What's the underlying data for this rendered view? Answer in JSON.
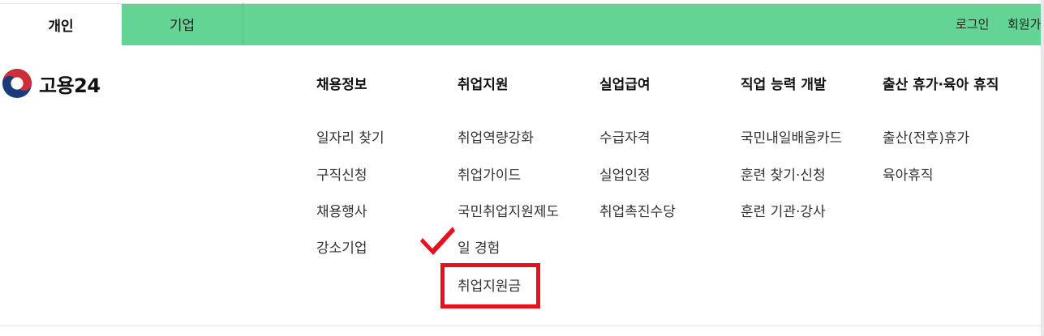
{
  "header": {
    "tabs": [
      {
        "label": "개인"
      },
      {
        "label": "기업"
      }
    ],
    "login": "로그인",
    "signup": "회원가"
  },
  "logo": {
    "text": "고용24"
  },
  "menu": [
    {
      "title": "채용정보",
      "items": [
        "일자리 찾기",
        "구직신청",
        "채용행사",
        "강소기업"
      ]
    },
    {
      "title": "취업지원",
      "items": [
        "취업역량강화",
        "취업가이드",
        "국민취업지원제도",
        "일 경험",
        "취업지원금"
      ]
    },
    {
      "title": "실업급여",
      "items": [
        "수급자격",
        "실업인정",
        "취업촉진수당"
      ]
    },
    {
      "title": "직업 능력 개발",
      "items": [
        "국민내일배움카드",
        "훈련 찾기·신청",
        "훈련 기관·강사"
      ]
    },
    {
      "title": "출산 휴가·육아 휴직",
      "items": [
        "출산(전후)휴가",
        "육아휴직"
      ]
    }
  ],
  "colors": {
    "top_bar": "#63d493",
    "highlight": "#e8101f",
    "check": "#e8101f"
  }
}
